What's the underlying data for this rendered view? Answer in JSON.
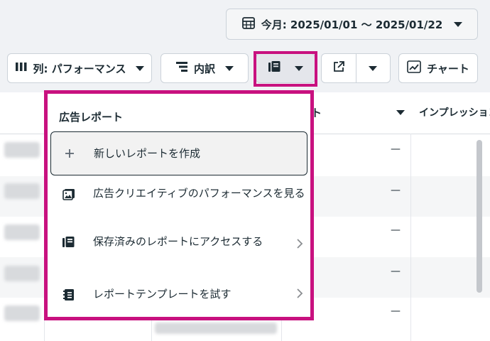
{
  "header": {
    "date_range_label": "今月: 2025/01/01 〜 2025/01/22",
    "calendar_icon": "calendar-icon"
  },
  "toolbar": {
    "columns_label": "列: パフォーマンス",
    "breakdown_label": "内訳",
    "reports_icon": "reports-icon",
    "export_icon": "export-icon",
    "chart_label": "チャート"
  },
  "table": {
    "header_partial": "ト",
    "impressions_header": "インプレッション",
    "empty_value": "—"
  },
  "report_menu": {
    "title": "広告レポート",
    "items": [
      {
        "label": "新しいレポートを作成",
        "icon": "plus-icon",
        "has_submenu": false
      },
      {
        "label": "広告クリエイティブのパフォーマンスを見る",
        "icon": "image-icon",
        "has_submenu": false
      },
      {
        "label": "保存済みのレポートにアクセスする",
        "icon": "saved-reports-icon",
        "has_submenu": true
      },
      {
        "label": "レポートテンプレートを試す",
        "icon": "template-icon",
        "has_submenu": true
      }
    ]
  },
  "colors": {
    "highlight": "#c8117f",
    "text": "#1c2b33",
    "toolbar_bg": "#f0f2f5"
  }
}
